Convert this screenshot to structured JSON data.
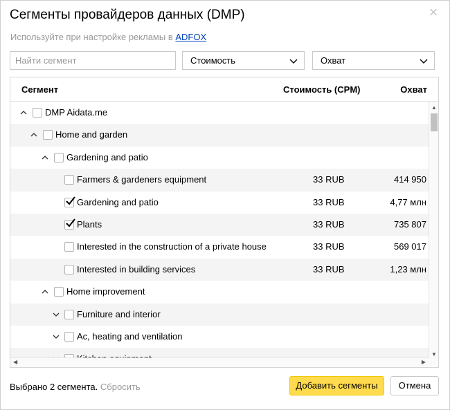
{
  "dialog": {
    "title": "Сегменты провайдеров данных (DMP)",
    "subtitle_text": "Используйте при настройке рекламы в",
    "subtitle_link": "ADFOX"
  },
  "filters": {
    "search_placeholder": "Найти сегмент",
    "cost_select": "Стоимость",
    "reach_select": "Охват"
  },
  "table": {
    "headers": {
      "segment": "Сегмент",
      "cost": "Стоимость (CPM)",
      "reach": "Охват"
    },
    "rows": [
      {
        "level": 0,
        "expander": "up",
        "label": "DMP Aidata.me",
        "checked": false,
        "cost": "",
        "reach": ""
      },
      {
        "level": 1,
        "expander": "up",
        "label": "Home and garden",
        "checked": false,
        "cost": "",
        "reach": ""
      },
      {
        "level": 2,
        "expander": "up",
        "label": "Gardening and patio",
        "checked": false,
        "cost": "",
        "reach": ""
      },
      {
        "level": 3,
        "expander": "none",
        "label": "Farmers & gardeners equipment",
        "checked": false,
        "cost": "33 RUB",
        "reach": "414 950"
      },
      {
        "level": 3,
        "expander": "none",
        "label": "Gardening and patio",
        "checked": true,
        "cost": "33 RUB",
        "reach": "4,77 млн"
      },
      {
        "level": 3,
        "expander": "none",
        "label": "Plants",
        "checked": true,
        "cost": "33 RUB",
        "reach": "735 807"
      },
      {
        "level": 3,
        "expander": "none",
        "label": "Interested in the construction of a private house",
        "checked": false,
        "cost": "33 RUB",
        "reach": "569 017"
      },
      {
        "level": 3,
        "expander": "none",
        "label": "Interested in building services",
        "checked": false,
        "cost": "33 RUB",
        "reach": "1,23 млн"
      },
      {
        "level": 2,
        "expander": "up",
        "label": "Home improvement",
        "checked": false,
        "cost": "",
        "reach": ""
      },
      {
        "level": 3,
        "expander": "down",
        "label": "Furniture and interior",
        "checked": false,
        "cost": "",
        "reach": ""
      },
      {
        "level": 3,
        "expander": "down",
        "label": "Ac, heating and ventilation",
        "checked": false,
        "cost": "",
        "reach": ""
      },
      {
        "level": 3,
        "expander": "down",
        "label": "Kitchen equipment",
        "checked": false,
        "cost": "",
        "reach": ""
      }
    ]
  },
  "footer": {
    "selected_text": "Выбрано 2 сегмента.",
    "reset_label": "Сбросить",
    "add_button": "Добавить сегменты",
    "cancel_button": "Отмена"
  },
  "colors": {
    "accent_button": "#ffdb4d",
    "link": "#0044bb",
    "alt_row": "#f4f4f4"
  }
}
